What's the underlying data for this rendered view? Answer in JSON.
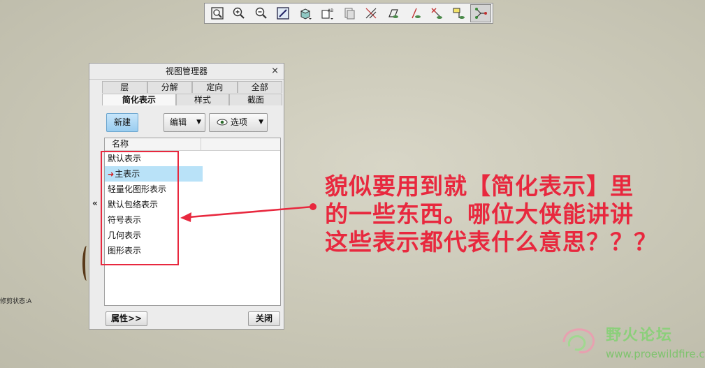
{
  "toolbar": {
    "buttons": [
      {
        "icon": "zoom-fit-icon",
        "active": false
      },
      {
        "icon": "zoom-in-icon",
        "active": false
      },
      {
        "icon": "zoom-out-icon",
        "active": false
      },
      {
        "icon": "repaint-icon",
        "active": false
      },
      {
        "icon": "shaded-display-icon",
        "active": false
      },
      {
        "icon": "saved-views-icon",
        "active": false
      },
      {
        "icon": "view-manager-icon",
        "active": false
      },
      {
        "icon": "datum-planes-icon",
        "active": false
      },
      {
        "icon": "datum-plane-display-icon",
        "active": false
      },
      {
        "icon": "datum-axis-display-icon",
        "active": false
      },
      {
        "icon": "datum-point-display-icon",
        "active": false
      },
      {
        "icon": "coordinate-system-icon",
        "active": false
      },
      {
        "icon": "spin-center-icon",
        "active": true
      }
    ]
  },
  "background": {
    "trim_status": "修剪状态:A"
  },
  "dialog": {
    "title": "视图管理器",
    "close_label": "×",
    "tabs_row1": [
      "层",
      "分解",
      "定向",
      "全部"
    ],
    "tabs_row2": [
      "简化表示",
      "样式",
      "截面"
    ],
    "selected_tab": "简化表示",
    "new_button": "新建",
    "edit_button": "编辑",
    "options_button": "选项",
    "column_name": "名称",
    "items": [
      {
        "label": "默认表示",
        "active": false
      },
      {
        "label": "主表示",
        "active": true
      },
      {
        "label": "轻量化图形表示",
        "active": false
      },
      {
        "label": "默认包络表示",
        "active": false
      },
      {
        "label": "符号表示",
        "active": false
      },
      {
        "label": "几何表示",
        "active": false
      },
      {
        "label": "图形表示",
        "active": false
      }
    ],
    "properties_button": "属性>>",
    "close_button": "关闭",
    "collapse_label": "«"
  },
  "annotation": {
    "line1": "貌似要用到就【简化表示】里",
    "line2": "的一些东西。哪位大侠能讲讲",
    "line3": "这些表示都代表什么意思？？？",
    "color": "#e8283e"
  },
  "watermark": {
    "name": "野火论坛",
    "url": "www.proewildfire.cn"
  }
}
